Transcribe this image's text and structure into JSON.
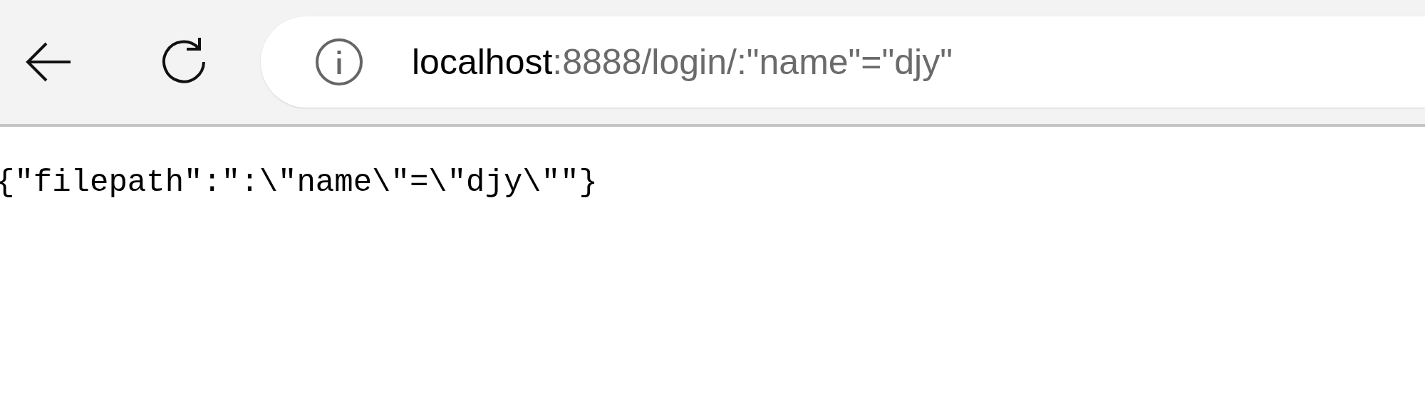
{
  "toolbar": {
    "address_bar": {
      "host": "localhost",
      "rest": ":8888/login/:\"name\"=\"djy\""
    }
  },
  "page": {
    "body_text": "{\"filepath\":\":\\\"name\\\"=\\\"djy\\\"\"}"
  }
}
